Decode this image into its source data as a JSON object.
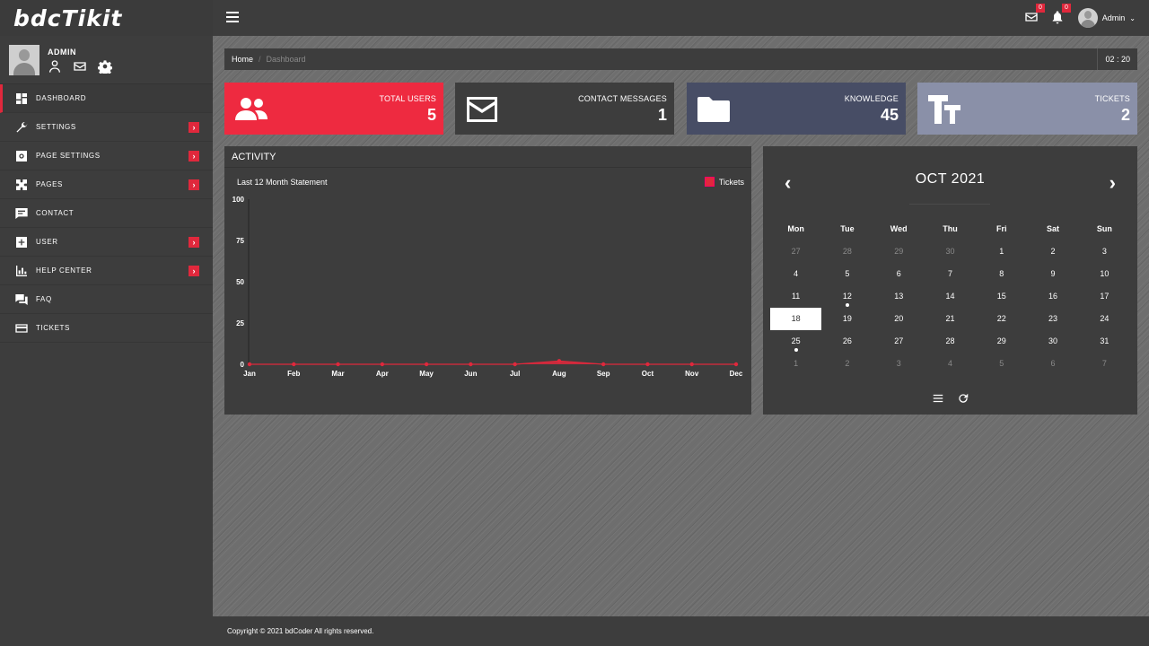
{
  "app": {
    "logo": "bdcTikit"
  },
  "profile": {
    "name": "ADMIN"
  },
  "sidebar": {
    "items": [
      {
        "label": "DASHBOARD",
        "has_submenu": false,
        "active": true
      },
      {
        "label": "SETTINGS",
        "has_submenu": true
      },
      {
        "label": "PAGE SETTINGS",
        "has_submenu": true
      },
      {
        "label": "PAGES",
        "has_submenu": true
      },
      {
        "label": "CONTACT",
        "has_submenu": false
      },
      {
        "label": "USER",
        "has_submenu": true
      },
      {
        "label": "HELP CENTER",
        "has_submenu": true
      },
      {
        "label": "FAQ",
        "has_submenu": false
      },
      {
        "label": "TICKETS",
        "has_submenu": false
      }
    ],
    "arrow": "›"
  },
  "topbar": {
    "mail_count": "0",
    "notification_count": "0",
    "user_name": "Admin",
    "caret": "⌄"
  },
  "breadcrumb": {
    "home": "Home",
    "separator": "/",
    "current": "Dashboard",
    "clock": "02 : 20"
  },
  "cards": [
    {
      "label": "TOTAL USERS",
      "value": "5",
      "color": "#ee2a40",
      "icon": "users-icon"
    },
    {
      "label": "CONTACT MESSAGES",
      "value": "1",
      "color": "#3d3d3d",
      "icon": "envelope-icon"
    },
    {
      "label": "KNOWLEDGE",
      "value": "45",
      "color": "#474d65",
      "icon": "folder-icon"
    },
    {
      "label": "TICKETS",
      "value": "2",
      "color": "#8a90a8",
      "icon": "text-size-icon"
    }
  ],
  "activity": {
    "title": "ACTIVITY",
    "subtitle": "Last 12 Month Statement"
  },
  "chart_data": {
    "type": "area",
    "categories": [
      "Jan",
      "Feb",
      "Mar",
      "Apr",
      "May",
      "Jun",
      "Jul",
      "Aug",
      "Sep",
      "Oct",
      "Nov",
      "Dec"
    ],
    "series": [
      {
        "name": "Tickets",
        "values": [
          0,
          0,
          0,
          0,
          0,
          0,
          0,
          2,
          0,
          0,
          0,
          0
        ],
        "color": "#e0283c"
      }
    ],
    "ylim": [
      0,
      100
    ],
    "yticks": [
      0,
      25,
      50,
      75,
      100
    ],
    "legend": "top-right",
    "grid": false
  },
  "calendar": {
    "title": "OCT 2021",
    "prev": "‹",
    "next": "›",
    "weekdays": [
      "Mon",
      "Tue",
      "Wed",
      "Thu",
      "Fri",
      "Sat",
      "Sun"
    ],
    "weeks": [
      [
        {
          "d": "27",
          "m": true
        },
        {
          "d": "28",
          "m": true
        },
        {
          "d": "29",
          "m": true
        },
        {
          "d": "30",
          "m": true
        },
        {
          "d": "1"
        },
        {
          "d": "2"
        },
        {
          "d": "3"
        }
      ],
      [
        {
          "d": "4"
        },
        {
          "d": "5"
        },
        {
          "d": "6"
        },
        {
          "d": "7"
        },
        {
          "d": "8"
        },
        {
          "d": "9"
        },
        {
          "d": "10"
        }
      ],
      [
        {
          "d": "11"
        },
        {
          "d": "12",
          "e": true
        },
        {
          "d": "13"
        },
        {
          "d": "14"
        },
        {
          "d": "15"
        },
        {
          "d": "16"
        },
        {
          "d": "17"
        }
      ],
      [
        {
          "d": "18",
          "t": true
        },
        {
          "d": "19"
        },
        {
          "d": "20"
        },
        {
          "d": "21"
        },
        {
          "d": "22"
        },
        {
          "d": "23"
        },
        {
          "d": "24"
        }
      ],
      [
        {
          "d": "25",
          "e": true
        },
        {
          "d": "26"
        },
        {
          "d": "27"
        },
        {
          "d": "28"
        },
        {
          "d": "29"
        },
        {
          "d": "30"
        },
        {
          "d": "31"
        }
      ],
      [
        {
          "d": "1",
          "m": true
        },
        {
          "d": "2",
          "m": true
        },
        {
          "d": "3",
          "m": true
        },
        {
          "d": "4",
          "m": true
        },
        {
          "d": "5",
          "m": true
        },
        {
          "d": "6",
          "m": true
        },
        {
          "d": "7",
          "m": true
        }
      ]
    ]
  },
  "footer": {
    "copyright": "Copyright © 2021 bdCoder All rights reserved."
  }
}
